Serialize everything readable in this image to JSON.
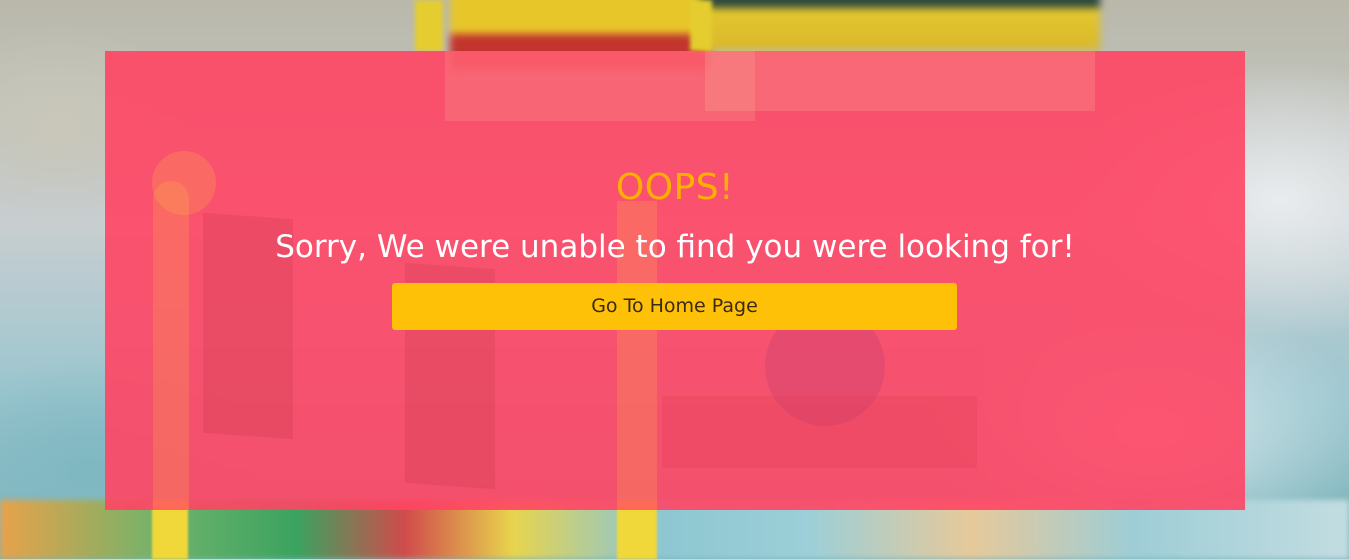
{
  "page": {
    "title": "OOPS!",
    "message": "Sorry, We were unable to find you were looking for!",
    "home_button_label": "Go To Home Page"
  },
  "colors": {
    "overlay": "#ff4564",
    "title": "#ffb000",
    "message": "#ffffff",
    "button_bg": "#ffc107",
    "button_text": "#3a2a12"
  }
}
